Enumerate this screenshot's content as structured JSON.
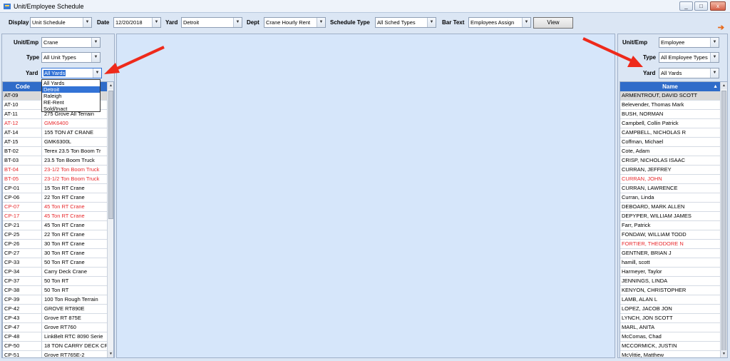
{
  "window": {
    "title": "Unit/Employee Schedule",
    "controls": [
      "_",
      "□",
      "x"
    ]
  },
  "toolbar": {
    "display_label": "Display",
    "display_value": "Unit Schedule",
    "date_label": "Date",
    "date_value": "12/20/2018",
    "yard_label": "Yard",
    "yard_value": "Detroit",
    "dept_label": "Dept",
    "dept_value": "Crane Hourly Rent",
    "sched_label": "Schedule Type",
    "sched_value": "All Sched Types",
    "bar_label": "Bar Text",
    "bar_value": "Employees Assign",
    "view_label": "View"
  },
  "left": {
    "unitemp_label": "Unit/Emp",
    "unitemp_value": "Crane",
    "type_label": "Type",
    "type_value": "All Unit Types",
    "yard_label": "Yard",
    "yard_value": "All Yards",
    "yard_options": [
      "All Yards",
      "Detroit",
      "Raleigh",
      "RE-Rent",
      "Sold/Inact"
    ],
    "code_header": "Code",
    "rows": [
      {
        "code": "AT-09",
        "name": "",
        "red": false,
        "sel": true
      },
      {
        "code": "AT-10",
        "name": "",
        "red": false
      },
      {
        "code": "AT-11",
        "name": "275 Grove All Terrain",
        "red": false
      },
      {
        "code": "AT-12",
        "name": "GMK6400",
        "red": true
      },
      {
        "code": "AT-14",
        "name": "155 TON AT CRANE",
        "red": false
      },
      {
        "code": "AT-15",
        "name": "GMK6300L",
        "red": false
      },
      {
        "code": "BT-02",
        "name": "Terex 23.5 Ton Boom Tr",
        "red": false
      },
      {
        "code": "BT-03",
        "name": "23.5 Ton Boom Truck",
        "red": false
      },
      {
        "code": "BT-04",
        "name": "23-1/2 Ton Boom Truck",
        "red": true
      },
      {
        "code": "BT-05",
        "name": "23-1/2 Ton Boom Truck",
        "red": true
      },
      {
        "code": "CP-01",
        "name": "15 Ton  RT Crane",
        "red": false
      },
      {
        "code": "CP-06",
        "name": "22 Ton RT Crane",
        "red": false
      },
      {
        "code": "CP-07",
        "name": "45 Ton RT Crane",
        "red": true
      },
      {
        "code": "CP-17",
        "name": "45 Ton  RT Crane",
        "red": true
      },
      {
        "code": "CP-21",
        "name": "45 Ton  RT Crane",
        "red": false
      },
      {
        "code": "CP-25",
        "name": "22 Ton RT Crane",
        "red": false
      },
      {
        "code": "CP-26",
        "name": "30 Ton RT  Crane",
        "red": false
      },
      {
        "code": "CP-27",
        "name": "30 Ton RT Crane",
        "red": false
      },
      {
        "code": "CP-33",
        "name": "50 Ton RT  Crane",
        "red": false
      },
      {
        "code": "CP-34",
        "name": "Carry Deck Crane",
        "red": false
      },
      {
        "code": "CP-37",
        "name": "50 Ton RT",
        "red": false
      },
      {
        "code": "CP-38",
        "name": "50 Ton RT",
        "red": false
      },
      {
        "code": "CP-39",
        "name": "100 Ton Rough Terrain",
        "red": false
      },
      {
        "code": "CP-42",
        "name": "GROVE RT890E",
        "red": false
      },
      {
        "code": "CP-43",
        "name": "Grove RT 875E",
        "red": false
      },
      {
        "code": "CP-47",
        "name": "Grove RT760",
        "red": false
      },
      {
        "code": "CP-48",
        "name": "LinkBelt RTC 8090 Serie",
        "red": false
      },
      {
        "code": "CP-50",
        "name": "18 TON CARRY DECK CR",
        "red": false
      },
      {
        "code": "CP-51",
        "name": "Grove RT765E-2",
        "red": false
      }
    ]
  },
  "right": {
    "unitemp_label": "Unit/Emp",
    "unitemp_value": "Employee",
    "type_label": "Type",
    "type_value": "All Employee Types",
    "yard_label": "Yard",
    "yard_value": "All Yards",
    "name_header": "Name",
    "rows": [
      {
        "name": "ARMENTROUT, DAVID SCOTT",
        "red": false,
        "sel": true
      },
      {
        "name": "Belevender, Thomas Mark",
        "red": false
      },
      {
        "name": "BUSH, NORMAN",
        "red": false
      },
      {
        "name": "Campbell, Collin Patrick",
        "red": false
      },
      {
        "name": "CAMPBELL, NICHOLAS R",
        "red": false
      },
      {
        "name": "Coffman, Michael",
        "red": false
      },
      {
        "name": "Cote, Adam",
        "red": false
      },
      {
        "name": "CRISP, NICHOLAS ISAAC",
        "red": false
      },
      {
        "name": "CURRAN, JEFFREY",
        "red": false
      },
      {
        "name": "CURRAN, JOHN",
        "red": true
      },
      {
        "name": "CURRAN, LAWRENCE",
        "red": false
      },
      {
        "name": "Curran, Linda",
        "red": false
      },
      {
        "name": "DEBOARD, MARK ALLEN",
        "red": false
      },
      {
        "name": "DEPYPER, WILLIAM JAMES",
        "red": false
      },
      {
        "name": "Farr, Patrick",
        "red": false
      },
      {
        "name": "FONDAW, WILLIAM TODD",
        "red": false
      },
      {
        "name": "FORTIER, THEODORE N",
        "red": true
      },
      {
        "name": "GENTNER, BRIAN J",
        "red": false
      },
      {
        "name": "hamill, scott",
        "red": false
      },
      {
        "name": "Harmeyer, Taylor",
        "red": false
      },
      {
        "name": "JENNINGS, LINDA",
        "red": false
      },
      {
        "name": "KENYON, CHRISTOPHER",
        "red": false
      },
      {
        "name": "LAMB, ALAN L",
        "red": false
      },
      {
        "name": "LOPEZ, JACOB JON",
        "red": false
      },
      {
        "name": "LYNCH, JON SCOTT",
        "red": false
      },
      {
        "name": "MARL, ANITA",
        "red": false
      },
      {
        "name": "McComas, Chad",
        "red": false
      },
      {
        "name": "MCCORMICK, JUSTIN",
        "red": false
      },
      {
        "name": "McVittie, Matthew",
        "red": false
      }
    ]
  },
  "colors": {
    "header_blue": "#2f6cc9",
    "alert_red": "#e8282c",
    "annotation_arrow": "#ee2a1b"
  },
  "icons": [
    "app-icon",
    "minimize-icon",
    "maximize-icon",
    "close-icon",
    "chevron-down-icon",
    "sort-up-icon",
    "scroll-up-icon",
    "scroll-down-icon",
    "arrow-right-icon"
  ]
}
